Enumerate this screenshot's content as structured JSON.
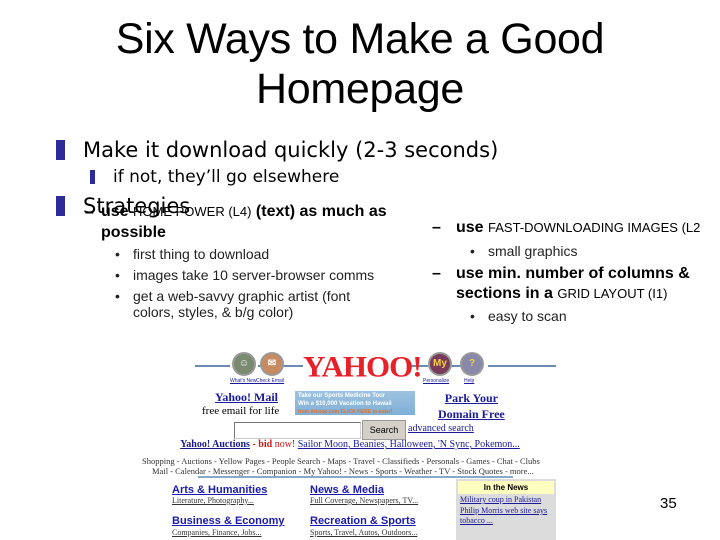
{
  "slide": {
    "title_line1": "Six Ways to Make a Good",
    "title_line2": "Homepage",
    "bullets": [
      {
        "text": "Make it download quickly (2-3 seconds)",
        "color": "#2b2b9a"
      },
      {
        "sub": "if not, they’ll go elsewhere"
      },
      {
        "text": "Strategies"
      }
    ],
    "left_column": {
      "item1_prefix": "use ",
      "item1_caps": "HOME POWER (L4)",
      "item1_suffix": " (text) as much as",
      "item1_line2": "possible",
      "subs": [
        "first thing to download",
        "images take 10 server-browser comms",
        "get a web-savvy graphic artist (font",
        "colors, styles, & b/g color)"
      ]
    },
    "right_column": {
      "item1_prefix": "use ",
      "item1_caps": "FAST-DOWNLOADING IMAGES (L2",
      "item1_sub": "small graphics",
      "item2_line1": "use min. number of columns &",
      "item2_line2_bold": "sections in a ",
      "item2_line2_caps": "GRID LAYOUT (I1)",
      "item2_sub": "easy to scan"
    },
    "dash": "–",
    "dot": "•",
    "page_number": "35"
  },
  "yahoo": {
    "logo": "YAHOO!",
    "icons": [
      {
        "name": "whats-new",
        "label": "What's New",
        "glyph": "☺"
      },
      {
        "name": "check-email",
        "label": "Check Email",
        "glyph": "✉"
      },
      {
        "name": "personalize",
        "label": "Personalize",
        "glyph": "My"
      },
      {
        "name": "help",
        "label": "Help",
        "glyph": "?"
      }
    ],
    "mail_title": "Yahoo! Mail",
    "mail_sub": "free email for life",
    "banner_line1": "Take our Sports Medicine Tour",
    "banner_line2": "Win a $10,000 Vacation to Hawaii",
    "banner_line3": "from drkoop.com  CLICK HERE to enter!",
    "park_line1": "Park Your",
    "park_line2": "Domain Free",
    "search_value": "",
    "search_button": "Search",
    "advanced_search": "advanced search",
    "auctions_label": "Yahoo! Auctions",
    "auctions_sep": " - ",
    "bid": "bid",
    "now": " now!",
    "auction_links": "Sailor Moon, Beanies, Halloween, 'N Sync, Pokemon...",
    "nav_row1": "Shopping - Auctions - Yellow Pages - People Search - Maps - Travel - Classifieds - Personals - Games - Chat - Clubs",
    "nav_row2": "Mail - Calendar - Messenger - Companion - My Yahoo! - News - Sports - Weather - TV - Stock Quotes - more...",
    "categories": [
      {
        "title": "Arts & Humanities",
        "sub": "Literature, Photography..."
      },
      {
        "title": "News & Media",
        "sub": "Full Coverage, Newspapers, TV..."
      },
      {
        "title": "Business & Economy",
        "sub": "Companies, Finance, Jobs..."
      },
      {
        "title": "Recreation & Sports",
        "sub": "Sports, Travel, Autos, Outdoors..."
      }
    ],
    "news": {
      "header": "In the News",
      "items": [
        "Military coup in Pakistan",
        "Philip Morris web site says tobacco ..."
      ]
    }
  }
}
